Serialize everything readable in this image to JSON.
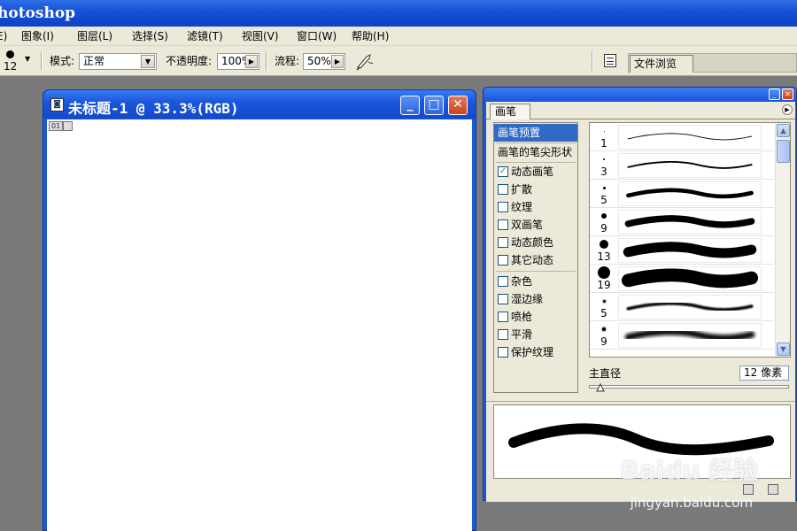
{
  "app": {
    "title": "hotoshop"
  },
  "menu": [
    {
      "label": "E)"
    },
    {
      "label": "图象(I)"
    },
    {
      "label": "图层(L)"
    },
    {
      "label": "选择(S)"
    },
    {
      "label": "滤镜(T)"
    },
    {
      "label": "视图(V)"
    },
    {
      "label": "窗口(W)"
    },
    {
      "label": "帮助(H)"
    }
  ],
  "options": {
    "brush_size": "12",
    "mode_label": "模式:",
    "mode_value": "正常",
    "opacity_label": "不透明度:",
    "opacity_value": "100%",
    "flow_label": "流程:",
    "flow_value": "50%",
    "file_browser_tab": "文件浏览"
  },
  "document": {
    "title": "未标题-1 @ 33.3%(RGB)",
    "tag": "01"
  },
  "brushes_panel": {
    "tab_label": "画笔",
    "sections": [
      {
        "label": "画笔预置",
        "type": "plain",
        "selected": true
      },
      {
        "label": "画笔的笔尖形状",
        "type": "plain",
        "selected": false
      },
      {
        "label": "动态画笔",
        "type": "check",
        "checked": true
      },
      {
        "label": "扩散",
        "type": "check",
        "checked": false
      },
      {
        "label": "纹理",
        "type": "check",
        "checked": false
      },
      {
        "label": "双画笔",
        "type": "check",
        "checked": false
      },
      {
        "label": "动态颜色",
        "type": "check",
        "checked": false
      },
      {
        "label": "其它动态",
        "type": "check",
        "checked": false
      },
      {
        "label": "杂色",
        "type": "check",
        "checked": false
      },
      {
        "label": "湿边缘",
        "type": "check",
        "checked": false
      },
      {
        "label": "喷枪",
        "type": "check",
        "checked": false
      },
      {
        "label": "平滑",
        "type": "check",
        "checked": false
      },
      {
        "label": "保护纹理",
        "type": "check",
        "checked": false
      }
    ],
    "presets": [
      {
        "size": "1",
        "dot": 1,
        "stroke": 1,
        "soft": false
      },
      {
        "size": "3",
        "dot": 2,
        "stroke": 2,
        "soft": false
      },
      {
        "size": "5",
        "dot": 3,
        "stroke": 5,
        "soft": false
      },
      {
        "size": "9",
        "dot": 6,
        "stroke": 8,
        "soft": false
      },
      {
        "size": "13",
        "dot": 10,
        "stroke": 12,
        "soft": false
      },
      {
        "size": "19",
        "dot": 14,
        "stroke": 16,
        "soft": false
      },
      {
        "size": "5",
        "dot": 3,
        "stroke": 4,
        "soft": true
      },
      {
        "size": "9",
        "dot": 4,
        "stroke": 8,
        "soft": true
      }
    ],
    "diameter_label": "主直径",
    "diameter_value": "12 像素",
    "diameter_fraction": 0.03
  },
  "watermark": {
    "brand": "Baidu 经验",
    "url": "jingyan.baidu.com"
  }
}
